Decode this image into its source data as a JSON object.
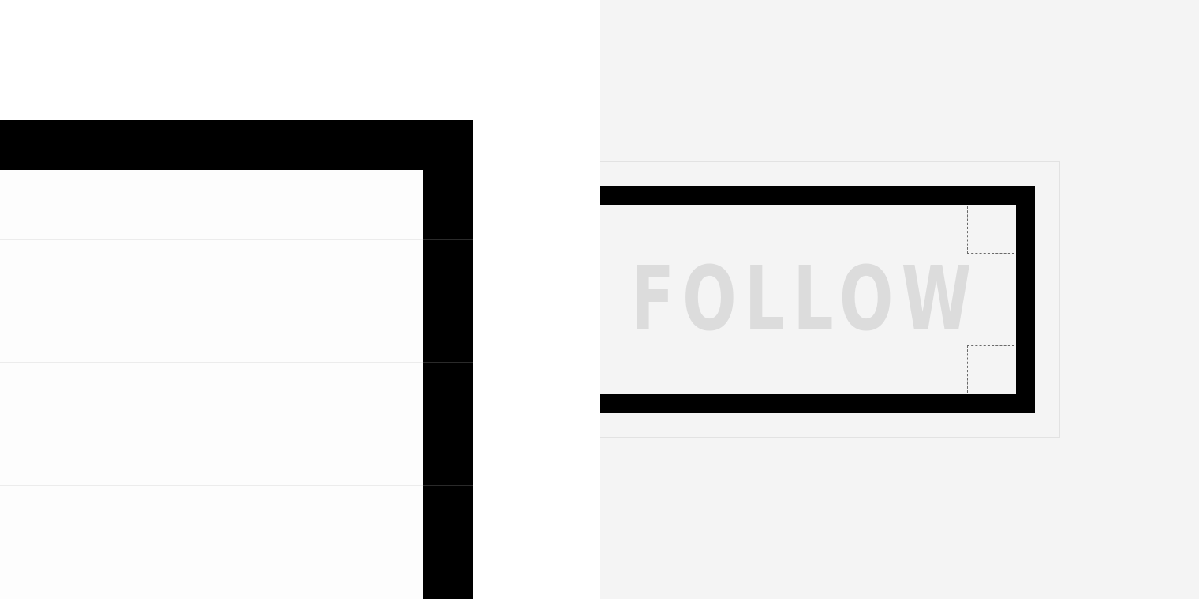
{
  "button": {
    "label": "FOLLOW"
  },
  "colors": {
    "frame": "#000000",
    "grid_line": "#ececec",
    "panel_left_bg": "#ffffff",
    "panel_right_bg": "#f4f4f4",
    "label_text": "#dcdcdc",
    "guide": "#d2d2d2"
  }
}
